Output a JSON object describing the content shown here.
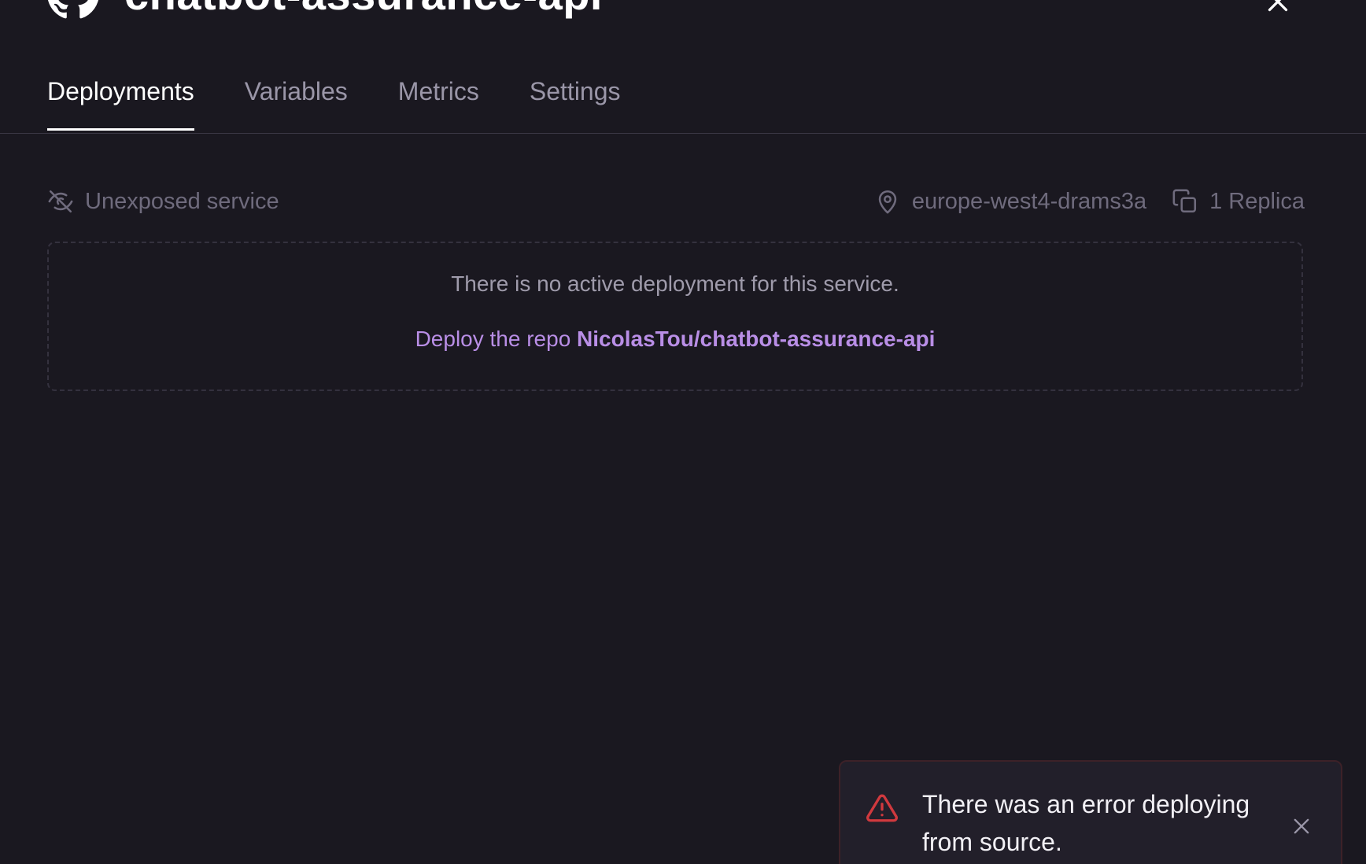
{
  "header": {
    "title": "chatbot-assurance-api",
    "icon": "github-icon",
    "close_icon": "close-icon"
  },
  "tabs": [
    {
      "label": "Deployments",
      "active": true
    },
    {
      "label": "Variables",
      "active": false
    },
    {
      "label": "Metrics",
      "active": false
    },
    {
      "label": "Settings",
      "active": false
    }
  ],
  "info": {
    "exposure": {
      "icon": "eye-off-icon",
      "label": "Unexposed service"
    },
    "region": {
      "icon": "map-pin-icon",
      "label": "europe-west4-drams3a"
    },
    "replicas": {
      "icon": "copy-icon",
      "label": "1 Replica"
    }
  },
  "empty_state": {
    "message": "There is no active deployment for this service.",
    "deploy_prefix": "Deploy the repo",
    "repo": "NicolasTou/chatbot-assurance-api"
  },
  "toast": {
    "icon": "warning-triangle-icon",
    "message": "There was an error deploying from source.",
    "close_icon": "close-icon"
  },
  "colors": {
    "background": "#1a1820",
    "accent": "#b98ee6",
    "muted": "#6f6b7d",
    "error": "#d0393e"
  }
}
